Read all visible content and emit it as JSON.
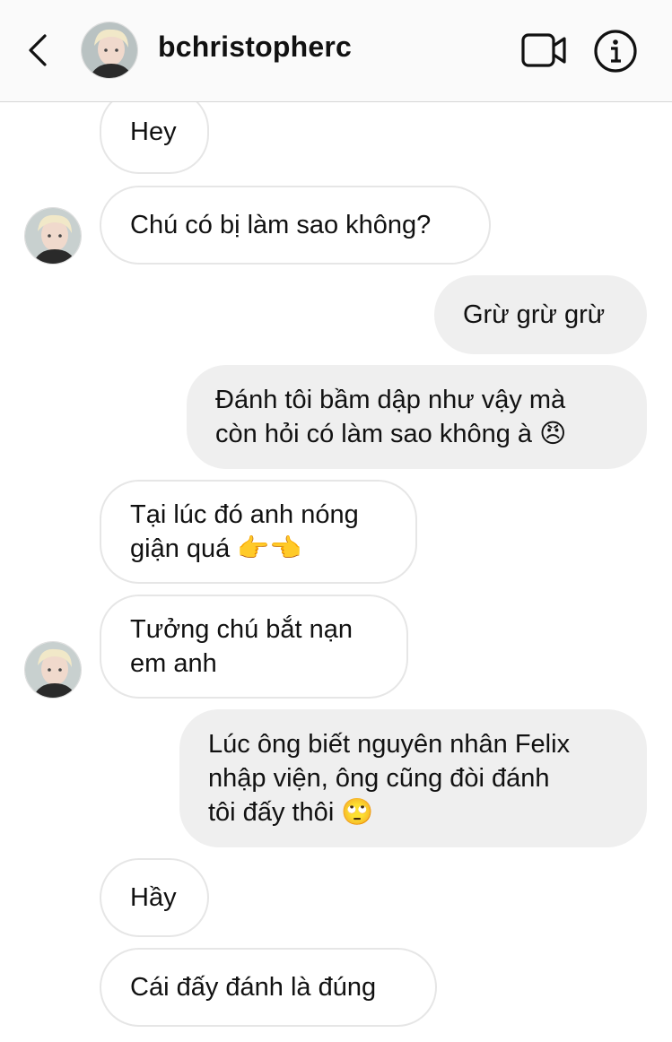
{
  "header": {
    "username": "bchristopherc",
    "back_icon": "chevron-left-icon",
    "video_icon": "video-camera-icon",
    "info_icon": "info-icon"
  },
  "messages": [
    {
      "sender": "them",
      "text": "Hey"
    },
    {
      "sender": "them",
      "text": "Chú có bị làm sao không?"
    },
    {
      "sender": "me",
      "text": "Grừ grừ grừ"
    },
    {
      "sender": "me",
      "text": "Đánh tôi bầm dập như vậy mà\ncòn hỏi có làm sao không à 😠"
    },
    {
      "sender": "them",
      "text": "Tại lúc đó anh nóng\ngiận quá 👉👈"
    },
    {
      "sender": "them",
      "text": "Tưởng chú bắt nạn\nem anh"
    },
    {
      "sender": "me",
      "text": "Lúc ông biết nguyên nhân Felix\nnhập viện, ông cũng đòi đánh\ntôi đấy thôi 🙄"
    },
    {
      "sender": "them",
      "text": "Hầy"
    },
    {
      "sender": "them",
      "text": "Cái đấy đánh là đúng"
    }
  ],
  "colors": {
    "header_bg": "#fafafa",
    "outgoing_bubble": "#efefef",
    "incoming_border": "#e6e6e6"
  }
}
